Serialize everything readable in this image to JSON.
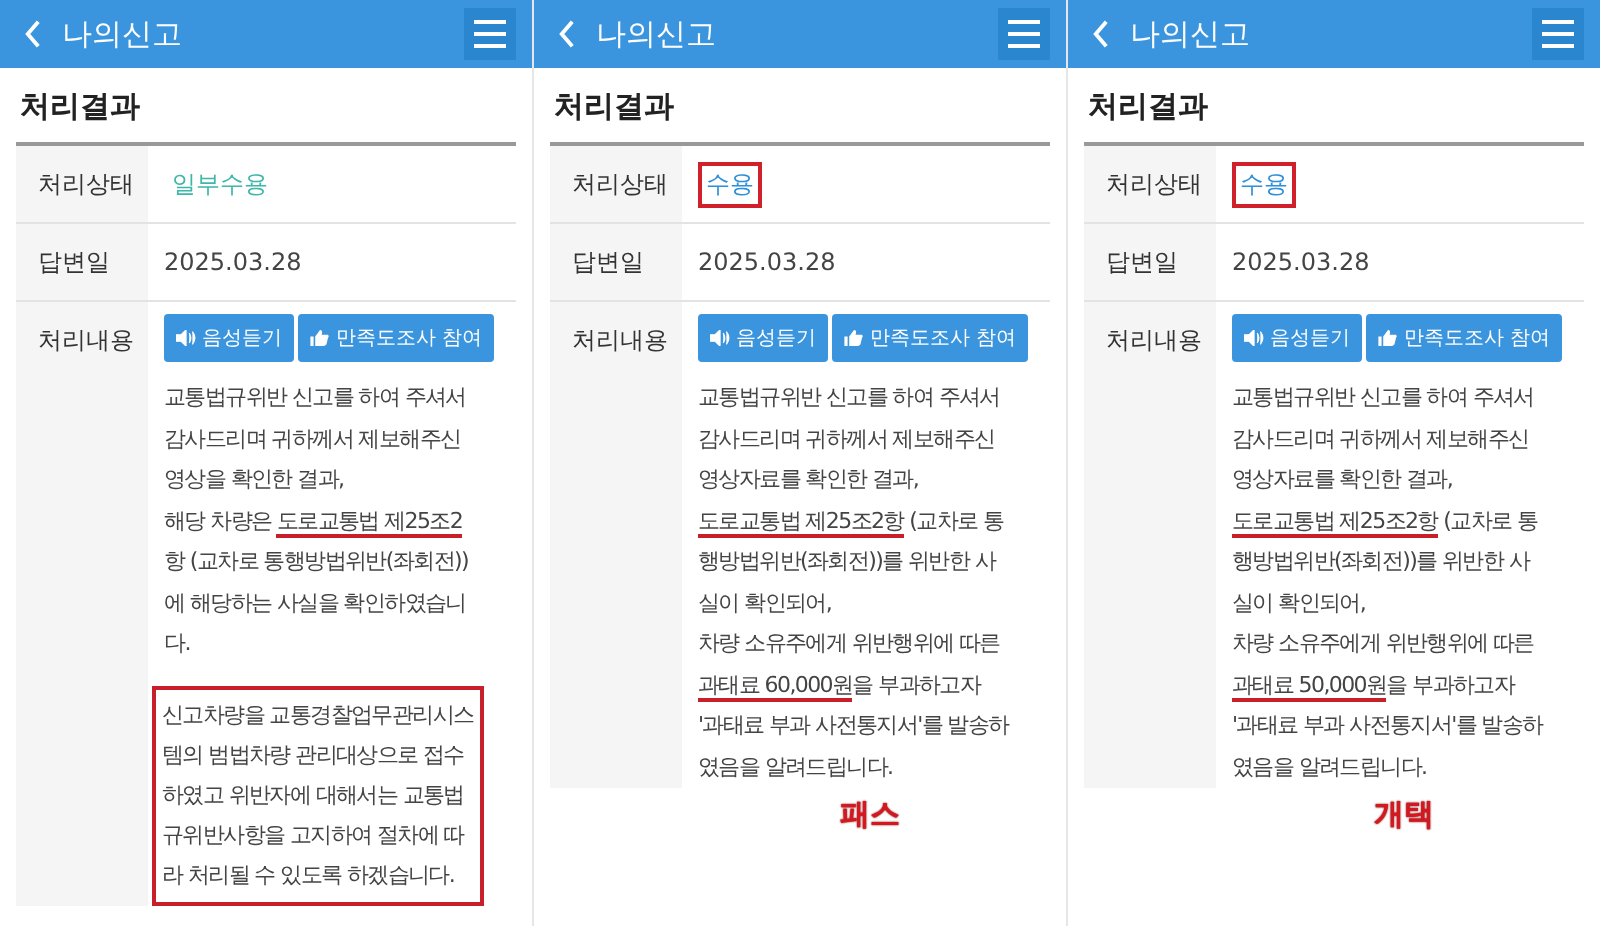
{
  "panels": [
    {
      "title": "나의신고",
      "section_title": "처리결과",
      "status_label": "처리상태",
      "status": {
        "text": "일부수용",
        "color": "#3fb7a8",
        "highlighted": false
      },
      "date_label": "답변일",
      "date": "2025.03.28",
      "content_label": "처리내용",
      "buttons": [
        {
          "kind": "listen",
          "label": "음성듣기"
        },
        {
          "kind": "survey",
          "label": "만족도조사 참여"
        }
      ],
      "lines": [
        [
          {
            "text": "교통법규위반 신고를 하여 주셔서",
            "underlined": false
          }
        ],
        [
          {
            "text": "감사드리며 귀하께서 제보해주신",
            "underlined": false
          }
        ],
        [
          {
            "text": "영상을 확인한 결과,",
            "underlined": false
          }
        ],
        [
          {
            "text": "해당 차량은 ",
            "underlined": false
          },
          {
            "text": "도로교통법 제25조2",
            "underlined": true
          }
        ],
        [
          {
            "text": "항 (교차로 통행방법위반(좌회전))",
            "underlined": false
          }
        ],
        [
          {
            "text": "에 해당하는 사실을 확인하였습니",
            "underlined": false
          }
        ],
        [
          {
            "text": "다.",
            "underlined": false
          }
        ]
      ],
      "note_lines": [
        "신고차량을 교통경찰업무관리시스",
        "템의 범법차량 관리대상으로 접수",
        "하였고 위반자에 대해서는 교통법",
        "규위반사항을 고지하여 절차에 따",
        "라 처리될 수 있도록 하겠습니다."
      ]
    },
    {
      "title": "나의신고",
      "section_title": "처리결과",
      "status_label": "처리상태",
      "status": {
        "text": "수용",
        "color": "#2f8fd8",
        "highlighted": true
      },
      "date_label": "답변일",
      "date": "2025.03.28",
      "content_label": "처리내용",
      "buttons": [
        {
          "kind": "listen",
          "label": "음성듣기"
        },
        {
          "kind": "survey",
          "label": "만족도조사 참여"
        }
      ],
      "lines": [
        [
          {
            "text": "교통법규위반 신고를 하여 주셔서",
            "underlined": false
          }
        ],
        [
          {
            "text": "감사드리며 귀하께서 제보해주신",
            "underlined": false
          }
        ],
        [
          {
            "text": "영상자료를 확인한 결과,",
            "underlined": false
          }
        ],
        [
          {
            "text": "도로교통법 제25조2항",
            "underlined": true
          },
          {
            "text": " (교차로 통",
            "underlined": false
          }
        ],
        [
          {
            "text": "행방법위반(좌회전))를 위반한 사",
            "underlined": false
          }
        ],
        [
          {
            "text": "실이 확인되어,",
            "underlined": false
          }
        ],
        [
          {
            "text": "차량 소유주에게 위반행위에 따른",
            "underlined": false
          }
        ],
        [
          {
            "text": "과태료 60,000원",
            "underlined": true
          },
          {
            "text": "을 부과하고자",
            "underlined": false
          }
        ],
        [
          {
            "text": "'과태료 부과 사전통지서'를 발송하",
            "underlined": false
          }
        ],
        [
          {
            "text": "였음을 알려드립니다.",
            "underlined": false
          }
        ]
      ],
      "caption": "패스"
    },
    {
      "title": "나의신고",
      "section_title": "처리결과",
      "status_label": "처리상태",
      "status": {
        "text": "수용",
        "color": "#2f8fd8",
        "highlighted": true
      },
      "date_label": "답변일",
      "date": "2025.03.28",
      "content_label": "처리내용",
      "buttons": [
        {
          "kind": "listen",
          "label": "음성듣기"
        },
        {
          "kind": "survey",
          "label": "만족도조사 참여"
        }
      ],
      "lines": [
        [
          {
            "text": "교통법규위반 신고를 하여 주셔서",
            "underlined": false
          }
        ],
        [
          {
            "text": "감사드리며 귀하께서 제보해주신",
            "underlined": false
          }
        ],
        [
          {
            "text": "영상자료를 확인한 결과,",
            "underlined": false
          }
        ],
        [
          {
            "text": "도로교통법 제25조2항",
            "underlined": true
          },
          {
            "text": " (교차로 통",
            "underlined": false
          }
        ],
        [
          {
            "text": "행방법위반(좌회전))를 위반한 사",
            "underlined": false
          }
        ],
        [
          {
            "text": "실이 확인되어,",
            "underlined": false
          }
        ],
        [
          {
            "text": "차량 소유주에게 위반행위에 따른",
            "underlined": false
          }
        ],
        [
          {
            "text": "과태료 50,000원",
            "underlined": true
          },
          {
            "text": "을 부과하고자",
            "underlined": false
          }
        ],
        [
          {
            "text": "'과태료 부과 사전통지서'를 발송하",
            "underlined": false
          }
        ],
        [
          {
            "text": "였음을 알려드립니다.",
            "underlined": false
          }
        ]
      ],
      "caption": "개택"
    }
  ]
}
